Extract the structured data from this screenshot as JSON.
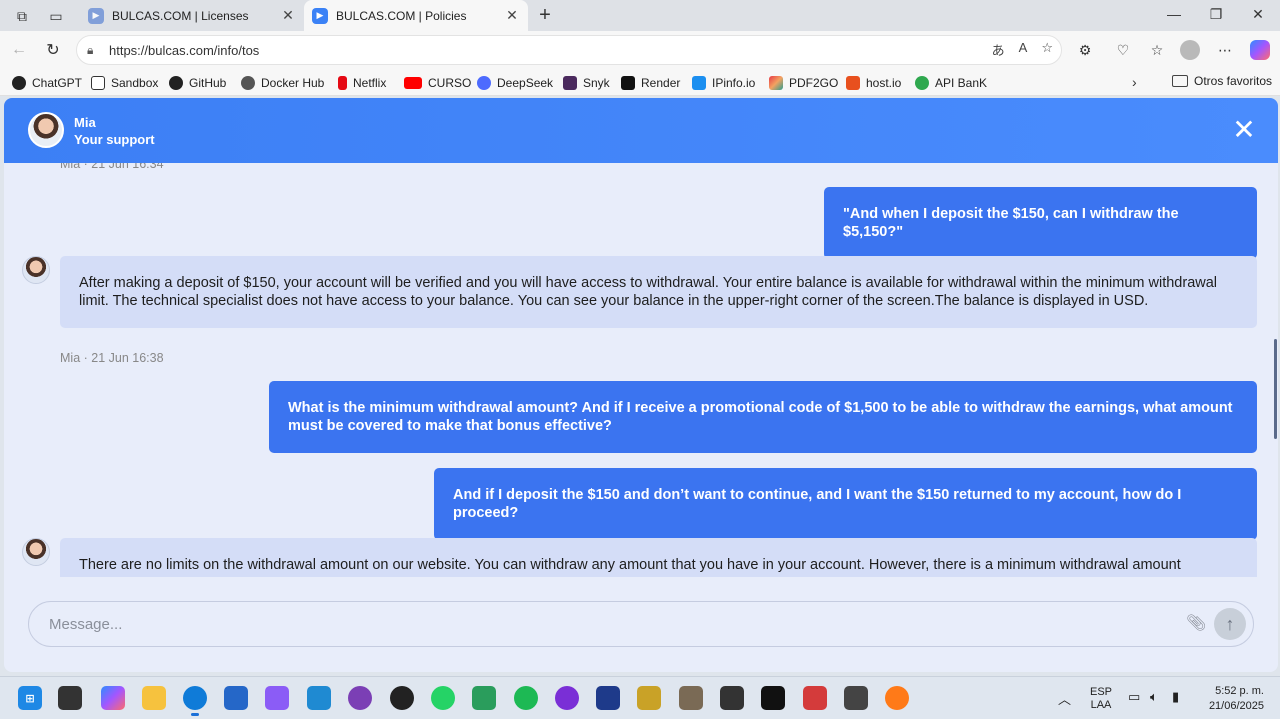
{
  "browser": {
    "tabs": [
      {
        "title": "BULCAS.COM | Licenses",
        "active": false
      },
      {
        "title": "BULCAS.COM | Policies",
        "active": true
      }
    ],
    "url": "https://bulcas.com/info/tos",
    "bookmarks": [
      "ChatGPT",
      "Sandbox",
      "GitHub",
      "Docker Hub",
      "Netflix",
      "CURSO",
      "DeepSeek",
      "Snyk",
      "Render",
      "IPinfo.io",
      "PDF2GO",
      "host.io",
      "API BanK"
    ],
    "other_bookmarks": "Otros favoritos"
  },
  "chat": {
    "agent_name": "Mia",
    "agent_role": "Your support",
    "messages": [
      {
        "from": "agent",
        "meta": "Mia · 21 Jun 16:34"
      },
      {
        "from": "user",
        "text": "\"And when I deposit the $150, can I withdraw the $5,150?\""
      },
      {
        "from": "agent",
        "text": "After making a deposit of $150, your account will be verified and you will have access to withdrawal. Your entire balance is available for withdrawal within the minimum withdrawal limit. The technical specialist does not have access to your balance. You can see your balance in the upper-right corner of the screen.The balance is displayed in USD.",
        "meta": "Mia · 21 Jun 16:38"
      },
      {
        "from": "user",
        "text": "What is the minimum withdrawal amount? And if I receive a promotional code of $1,500 to be able to withdraw the earnings, what amount must be covered to make that bonus effective?"
      },
      {
        "from": "user",
        "text": "And if I deposit the $150 and don’t want to continue, and I want the $150 returned to my account, how do I proceed?"
      },
      {
        "from": "agent",
        "text": "There are no limits on the withdrawal amount on our website. You can withdraw any amount that you have in your account. However, there is a minimum withdrawal amount"
      }
    ],
    "composer_placeholder": "Message..."
  },
  "taskbar": {
    "language": "ESP",
    "layout": "LAA",
    "time": "5:52 p. m.",
    "date": "21/06/2025"
  }
}
